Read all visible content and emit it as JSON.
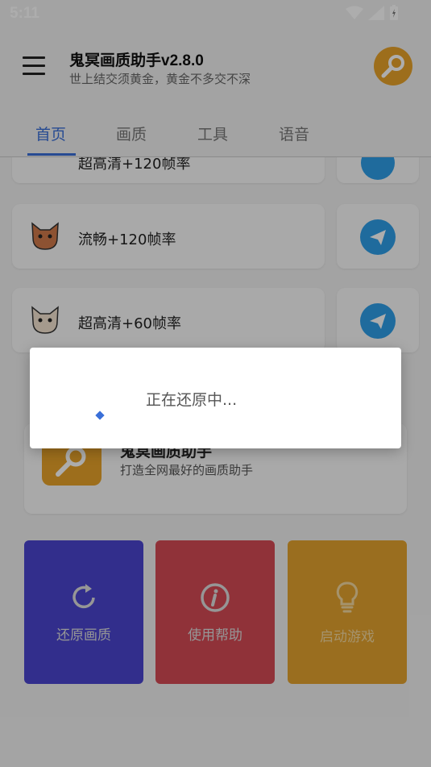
{
  "status_bar": {
    "time": "5:11"
  },
  "header": {
    "title": "鬼冥画质助手v2.8.0",
    "subtitle": "世上结交须黄金，黄金不多交不深"
  },
  "tabs": [
    {
      "label": "首页",
      "active": true
    },
    {
      "label": "画质",
      "active": false
    },
    {
      "label": "工具",
      "active": false
    },
    {
      "label": "语音",
      "active": false
    }
  ],
  "options": [
    {
      "label": "超高清+120帧率"
    },
    {
      "label": "流畅+120帧率"
    },
    {
      "label": "超高清+60帧率"
    }
  ],
  "app_card": {
    "name": "鬼冥画质助手",
    "slogan": "打造全网最好的画质助手"
  },
  "actions": [
    {
      "label": "还原画质",
      "color": "#4a44cf",
      "icon": "refresh-icon"
    },
    {
      "label": "使用帮助",
      "color": "#d54a55",
      "icon": "info-icon"
    },
    {
      "label": "启动游戏",
      "color": "#e4a22e",
      "icon": "lightbulb-icon"
    }
  ],
  "dialog": {
    "message": "正在还原中..."
  },
  "colors": {
    "accent": "#3a6fd8",
    "send_button": "#2f9ee8",
    "avatar": "#e8a32a"
  }
}
